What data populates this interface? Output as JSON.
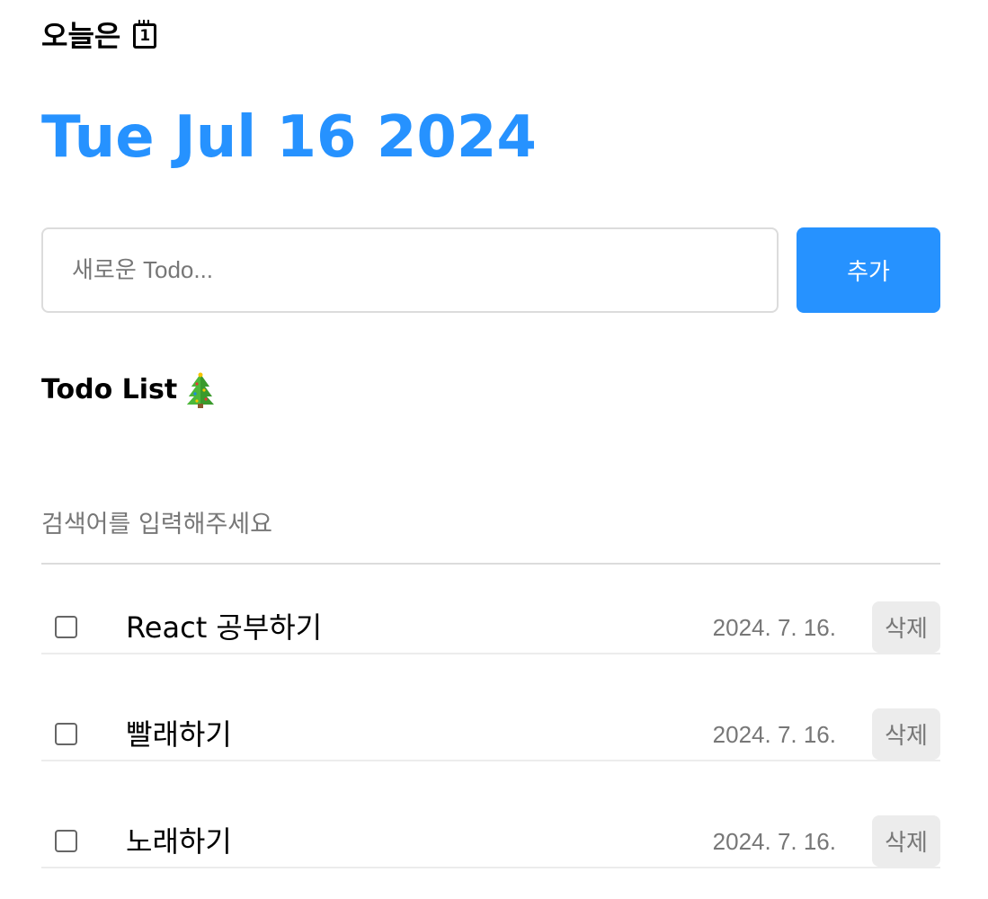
{
  "header": {
    "title": "오늘은",
    "calendar_icon_digit": "1",
    "date": "Tue Jul 16 2024"
  },
  "editor": {
    "placeholder": "새로운 Todo...",
    "value": "",
    "add_label": "추가"
  },
  "list": {
    "title": "Todo List",
    "title_icon": "christmas-tree-icon",
    "search_placeholder": "검색어를 입력해주세요",
    "delete_label": "삭제",
    "items": [
      {
        "content": "React 공부하기",
        "date": "2024. 7. 16.",
        "done": false
      },
      {
        "content": "빨래하기",
        "date": "2024. 7. 16.",
        "done": false
      },
      {
        "content": "노래하기",
        "date": "2024. 7. 16.",
        "done": false
      }
    ]
  },
  "colors": {
    "accent": "#2692ff",
    "muted_text": "#777777",
    "border": "#dcdcdc",
    "delete_bg": "#ececec"
  }
}
